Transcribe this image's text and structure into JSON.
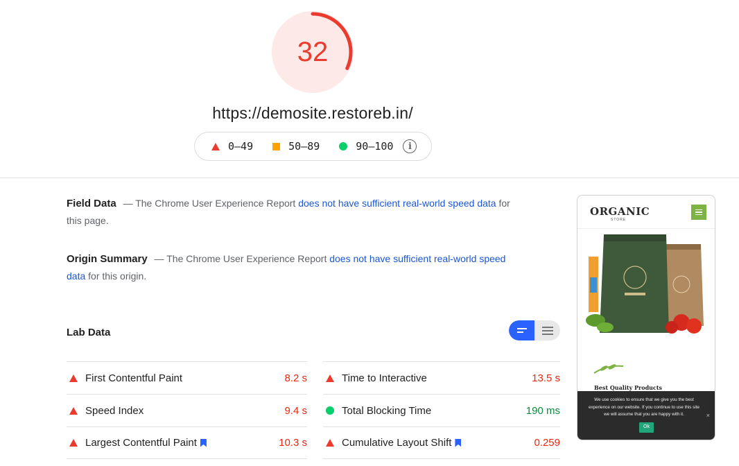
{
  "score": {
    "value": "32",
    "fraction": 0.32,
    "color": "#eb3b2e"
  },
  "url": "https://demosite.restoreb.in/",
  "legend": {
    "items": [
      {
        "range": "0–49",
        "shape": "triangle",
        "color": "#eb3b2e"
      },
      {
        "range": "50–89",
        "shape": "square",
        "color": "#ffa400"
      },
      {
        "range": "90–100",
        "shape": "circle",
        "color": "#0cce6b"
      }
    ],
    "info_icon": "info-icon"
  },
  "field_data": {
    "heading": "Field Data",
    "dash": "—",
    "text_before": "The Chrome User Experience Report",
    "link": "does not have sufficient real-world speed data",
    "text_after": "for this page."
  },
  "origin_summary": {
    "heading": "Origin Summary",
    "dash": "—",
    "text_before": "The Chrome User Experience Report",
    "link": "does not have sufficient real-world speed data",
    "text_after": "for this origin."
  },
  "lab_data": {
    "heading": "Lab Data",
    "toggle": {
      "active": "summary-view",
      "inactive": "list-view"
    },
    "left_metrics": [
      {
        "label": "First Contentful Paint",
        "value": "8.2 s",
        "status": "fail",
        "bookmark": false
      },
      {
        "label": "Speed Index",
        "value": "9.4 s",
        "status": "fail",
        "bookmark": false
      },
      {
        "label": "Largest Contentful Paint",
        "value": "10.3 s",
        "status": "fail",
        "bookmark": true
      }
    ],
    "right_metrics": [
      {
        "label": "Time to Interactive",
        "value": "13.5 s",
        "status": "fail",
        "bookmark": false
      },
      {
        "label": "Total Blocking Time",
        "value": "190 ms",
        "status": "pass",
        "bookmark": false
      },
      {
        "label": "Cumulative Layout Shift",
        "value": "0.259",
        "status": "fail",
        "bookmark": true
      }
    ]
  },
  "thumbnail": {
    "logo": "ORGANIC",
    "logo_sub": "STORE",
    "section_title": "Best Quality Products",
    "cookie_text": "We use cookies to ensure that we give you the best experience on our website. If you continue to use this site we will assume that you are happy with it.",
    "cookie_close": "×",
    "cookie_ok": "Ok",
    "menu_color": "#7cb342"
  }
}
